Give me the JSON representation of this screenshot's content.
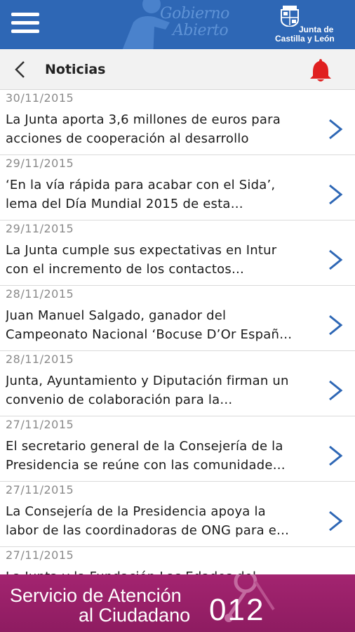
{
  "topbar": {
    "logo_line1": "Gobierno",
    "logo_line2": "Abierto",
    "brand_line1": "Junta de",
    "brand_line2": "Castilla y León",
    "accent_color": "#2e67b5"
  },
  "header": {
    "title": "Noticias",
    "bell_color": "#e02020"
  },
  "news": [
    {
      "date": "30/11/2015",
      "line1": "La Junta aporta 3,6 millones de euros para",
      "line2": "acciones de cooperación al desarrollo"
    },
    {
      "date": "29/11/2015",
      "line1": "‘En la vía rápida para acabar con el Sida’,",
      "line2": "lema del Día Mundial 2015 de esta…"
    },
    {
      "date": "29/11/2015",
      "line1": "La Junta cumple sus expectativas en Intur",
      "line2": "con el incremento de los contactos…"
    },
    {
      "date": "28/11/2015",
      "line1": "Juan Manuel Salgado, ganador del",
      "line2": "Campeonato Nacional ‘Bocuse D’Or Españ…"
    },
    {
      "date": "28/11/2015",
      "line1": "Junta, Ayuntamiento y Diputación firman un",
      "line2": "convenio de colaboración para la…"
    },
    {
      "date": "27/11/2015",
      "line1": "El secretario general de la Consejería de la",
      "line2": "Presidencia se reúne con las comunidade…"
    },
    {
      "date": "27/11/2015",
      "line1": "La Consejería de la Presidencia apoya la",
      "line2": "labor de las coordinadoras de ONG para e…"
    },
    {
      "date": "27/11/2015",
      "line1": "La Junta y la Fundación Las Edades del",
      "line2": ""
    }
  ],
  "footer": {
    "line1": "Servicio de Atención",
    "line2": "al Ciudadano",
    "number": "012",
    "color": "#a32470"
  }
}
